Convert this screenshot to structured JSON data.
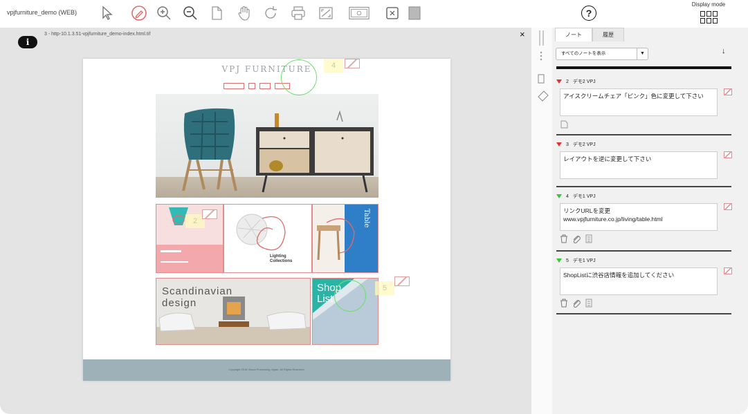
{
  "toolbar": {
    "doc_name": "vpjfurniture_demo (WEB)",
    "icons": [
      "pointer-icon",
      "pen-icon",
      "zoom-in-icon",
      "zoom-out-icon",
      "page-icon",
      "hand-icon",
      "rotate-icon",
      "print-icon",
      "fit-icon",
      "screenshot-icon",
      "fullscreen-icon",
      "square-icon"
    ],
    "help_label": "?",
    "display_mode_label": "Display mode"
  },
  "viewer": {
    "file_label": "3 - http-10.1.3.51-vpjfurniture_demo-index.html.tif",
    "close_label": "×",
    "info_label": "i"
  },
  "mock_page": {
    "site_title": "VPJ FURNITURE",
    "copyright": "Copyright 2018 Visual Processing Japan. All Rights Reserved.",
    "lighting_label": "Lighting Collections",
    "scandinavian_label": "Scandinavian design",
    "shop_list_label": "Shop List",
    "table_label": "Table",
    "note_numbers": [
      "4",
      "2",
      "5"
    ]
  },
  "panel": {
    "tabs": [
      "ノート",
      "履歴"
    ],
    "filter_label": "すべてのノートを表示",
    "sort_icon": "↓",
    "notes": [
      {
        "num": "2",
        "author": "デモ2 VPJ",
        "color": "#e23333",
        "text": "アイスクリームチェア「ピンク」色に変更して下さい"
      },
      {
        "num": "3",
        "author": "デモ2 VPJ",
        "color": "#e23333",
        "text": "レイアウトを逆に変更して下さい"
      },
      {
        "num": "4",
        "author": "デモ1 VPJ",
        "color": "#39c439",
        "text": "リンクURLを変更\nwww.vpjfurniture.co.jp/living/table.html"
      },
      {
        "num": "5",
        "author": "デモ1 VPJ",
        "color": "#39c439",
        "text": "ShopListに渋谷店情報を追加してください"
      }
    ]
  }
}
